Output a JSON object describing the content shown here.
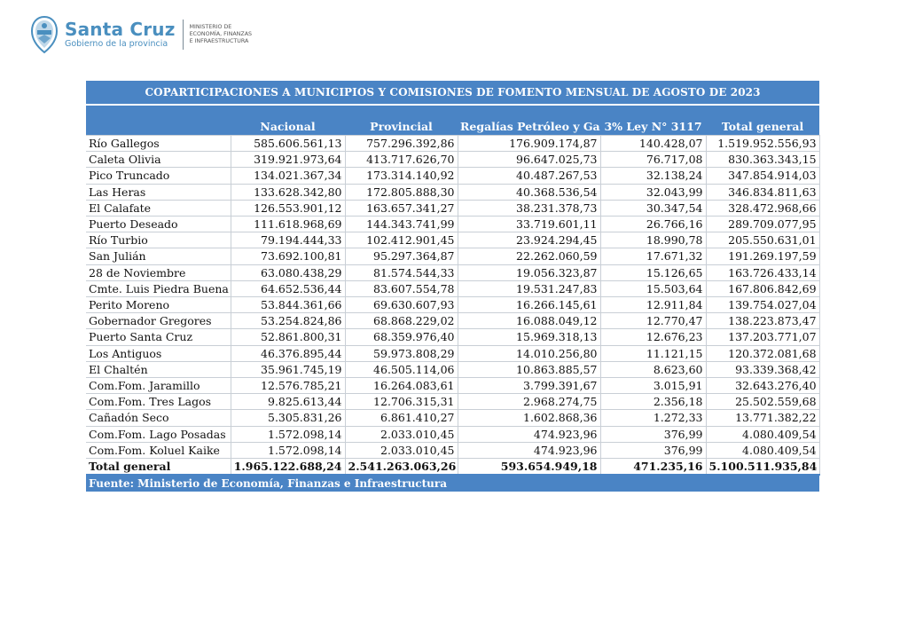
{
  "header": {
    "brand_name": "Santa Cruz",
    "brand_sub": "Gobierno de la provincia",
    "ministry_lines": [
      "Ministerio de",
      "Economía, Finanzas",
      "e Infraestructura"
    ]
  },
  "colors": {
    "brand": "#4a8fbf",
    "table_header": "#4a84c5"
  },
  "table": {
    "title": "COPARTICIPACIONES A MUNICIPIOS Y COMISIONES DE FOMENTO  MENSUAL  DE  AGOSTO  DE  2023",
    "columns": [
      "",
      "Nacional",
      "Provincial",
      "Regalías Petróleo y Gas",
      "3% Ley N° 3117",
      "Total general"
    ],
    "rows": [
      [
        "Río Gallegos",
        "585.606.561,13",
        "757.296.392,86",
        "176.909.174,87",
        "140.428,07",
        "1.519.952.556,93"
      ],
      [
        "Caleta Olivia",
        "319.921.973,64",
        "413.717.626,70",
        "96.647.025,73",
        "76.717,08",
        "830.363.343,15"
      ],
      [
        "Pico Truncado",
        "134.021.367,34",
        "173.314.140,92",
        "40.487.267,53",
        "32.138,24",
        "347.854.914,03"
      ],
      [
        "Las Heras",
        "133.628.342,80",
        "172.805.888,30",
        "40.368.536,54",
        "32.043,99",
        "346.834.811,63"
      ],
      [
        "El Calafate",
        "126.553.901,12",
        "163.657.341,27",
        "38.231.378,73",
        "30.347,54",
        "328.472.968,66"
      ],
      [
        "Puerto Deseado",
        "111.618.968,69",
        "144.343.741,99",
        "33.719.601,11",
        "26.766,16",
        "289.709.077,95"
      ],
      [
        "Río Turbio",
        "79.194.444,33",
        "102.412.901,45",
        "23.924.294,45",
        "18.990,78",
        "205.550.631,01"
      ],
      [
        "San Julián",
        "73.692.100,81",
        "95.297.364,87",
        "22.262.060,59",
        "17.671,32",
        "191.269.197,59"
      ],
      [
        "28 de Noviembre",
        "63.080.438,29",
        "81.574.544,33",
        "19.056.323,87",
        "15.126,65",
        "163.726.433,14"
      ],
      [
        "Cmte. Luis Piedra Buena",
        "64.652.536,44",
        "83.607.554,78",
        "19.531.247,83",
        "15.503,64",
        "167.806.842,69"
      ],
      [
        "Perito Moreno",
        "53.844.361,66",
        "69.630.607,93",
        "16.266.145,61",
        "12.911,84",
        "139.754.027,04"
      ],
      [
        "Gobernador Gregores",
        "53.254.824,86",
        "68.868.229,02",
        "16.088.049,12",
        "12.770,47",
        "138.223.873,47"
      ],
      [
        "Puerto Santa Cruz",
        "52.861.800,31",
        "68.359.976,40",
        "15.969.318,13",
        "12.676,23",
        "137.203.771,07"
      ],
      [
        "Los Antiguos",
        "46.376.895,44",
        "59.973.808,29",
        "14.010.256,80",
        "11.121,15",
        "120.372.081,68"
      ],
      [
        "El Chaltén",
        "35.961.745,19",
        "46.505.114,06",
        "10.863.885,57",
        "8.623,60",
        "93.339.368,42"
      ],
      [
        "Com.Fom. Jaramillo",
        "12.576.785,21",
        "16.264.083,61",
        "3.799.391,67",
        "3.015,91",
        "32.643.276,40"
      ],
      [
        "Com.Fom. Tres Lagos",
        "9.825.613,44",
        "12.706.315,31",
        "2.968.274,75",
        "2.356,18",
        "25.502.559,68"
      ],
      [
        "Cañadón Seco",
        "5.305.831,26",
        "6.861.410,27",
        "1.602.868,36",
        "1.272,33",
        "13.771.382,22"
      ],
      [
        "Com.Fom. Lago Posadas",
        "1.572.098,14",
        "2.033.010,45",
        "474.923,96",
        "376,99",
        "4.080.409,54"
      ],
      [
        "Com.Fom. Koluel Kaike",
        "1.572.098,14",
        "2.033.010,45",
        "474.923,96",
        "376,99",
        "4.080.409,54"
      ]
    ],
    "total": [
      "Total general",
      "1.965.122.688,24",
      "2.541.263.063,26",
      "593.654.949,18",
      "471.235,16",
      "5.100.511.935,84"
    ],
    "source": "Fuente: Ministerio de Economía, Finanzas e Infraestructura"
  }
}
